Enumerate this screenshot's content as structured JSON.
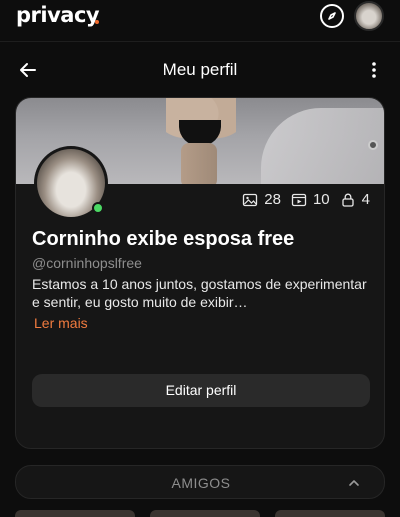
{
  "app": {
    "logo": "privacy"
  },
  "header": {
    "title": "Meu perfil"
  },
  "profile": {
    "name": "Corninho exibe esposa free",
    "handle": "@corninhopslfree",
    "bio": "Estamos a 10 anos juntos, gostamos de experimentar e sentir, eu gosto muito de exibir…",
    "read_more": "Ler mais",
    "edit_label": "Editar perfil",
    "stats": {
      "photos": "28",
      "videos": "10",
      "locked": "4"
    }
  },
  "friends": {
    "label": "AMIGOS"
  },
  "colors": {
    "accent": "#f07b3f",
    "online": "#4cd964",
    "background": "#0d0d0d",
    "card": "#161616"
  },
  "icons": [
    "compass-icon",
    "back-arrow-icon",
    "more-vertical-icon",
    "image-icon",
    "video-icon",
    "lock-icon",
    "chevron-up-icon"
  ]
}
